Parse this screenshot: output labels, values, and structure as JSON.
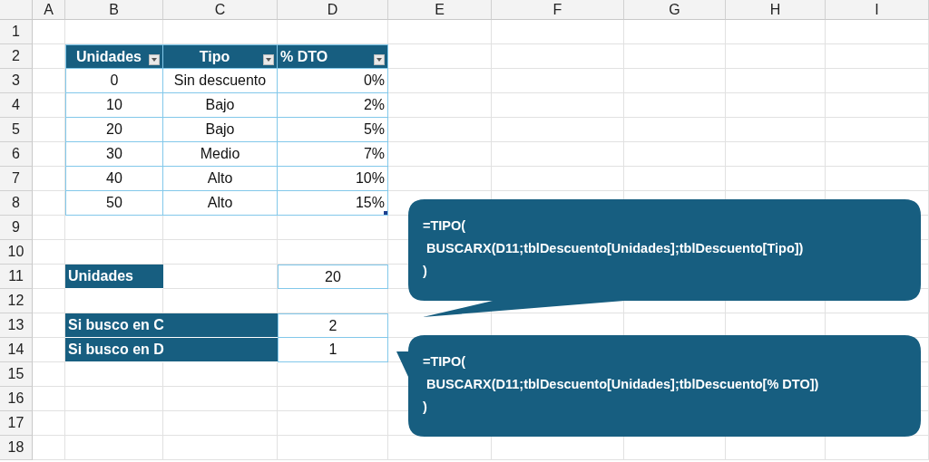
{
  "columns": [
    "A",
    "B",
    "C",
    "D",
    "E",
    "F",
    "G",
    "H",
    "I"
  ],
  "rows": [
    "1",
    "2",
    "3",
    "4",
    "5",
    "6",
    "7",
    "8",
    "9",
    "10",
    "11",
    "12",
    "13",
    "14",
    "15",
    "16",
    "17",
    "18"
  ],
  "table": {
    "columns": [
      {
        "label": "Unidades"
      },
      {
        "label": "Tipo"
      },
      {
        "label": "% DTO"
      }
    ],
    "rows": [
      [
        "0",
        "Sin descuento",
        "0%"
      ],
      [
        "10",
        "Bajo",
        "2%"
      ],
      [
        "20",
        "Bajo",
        "5%"
      ],
      [
        "30",
        "Medio",
        "7%"
      ],
      [
        "40",
        "Alto",
        "10%"
      ],
      [
        "50",
        "Alto",
        "15%"
      ]
    ]
  },
  "input": {
    "label": "Unidades",
    "value": "20"
  },
  "results": [
    {
      "label": "Si busco en C",
      "value": "2"
    },
    {
      "label": "Si busco en D",
      "value": "1"
    }
  ],
  "callouts": [
    {
      "kind": "tail-below",
      "lines": [
        "=TIPO(",
        " BUSCARX(D11;tblDescuento[Unidades];tblDescuento[Tipo])",
        ")"
      ]
    },
    {
      "kind": "tail-left",
      "lines": [
        "=TIPO(",
        " BUSCARX(D11;tblDescuento[Unidades];tblDescuento[% DTO])",
        ")"
      ]
    }
  ]
}
